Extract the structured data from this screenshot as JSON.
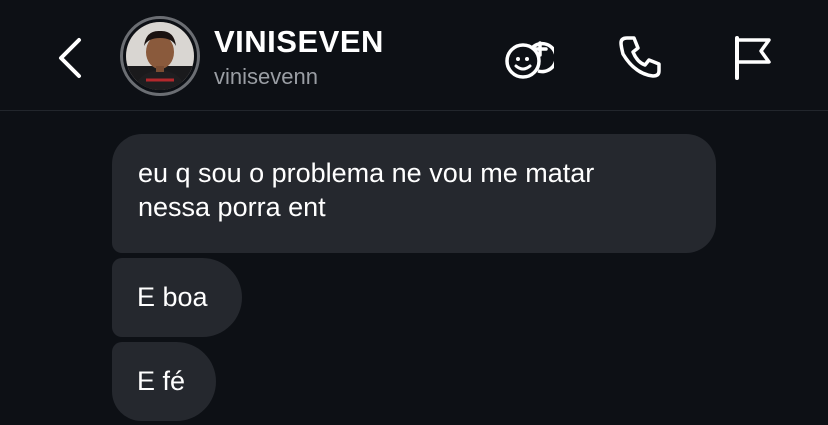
{
  "header": {
    "title": "VINISEVEN",
    "subtitle": "vinisevenn",
    "icons": [
      "back-icon",
      "avatar",
      "games-icon",
      "phone-icon",
      "flag-icon"
    ]
  },
  "messages": [
    {
      "text": "eu q sou o problema ne vou me matar\nnessa porra ent"
    },
    {
      "text": "E boa"
    },
    {
      "text": "E fé"
    }
  ],
  "colors": {
    "background": "#0d1015",
    "bubble": "#25282e",
    "text": "#ffffff",
    "subtitle": "#9a9ea4"
  }
}
